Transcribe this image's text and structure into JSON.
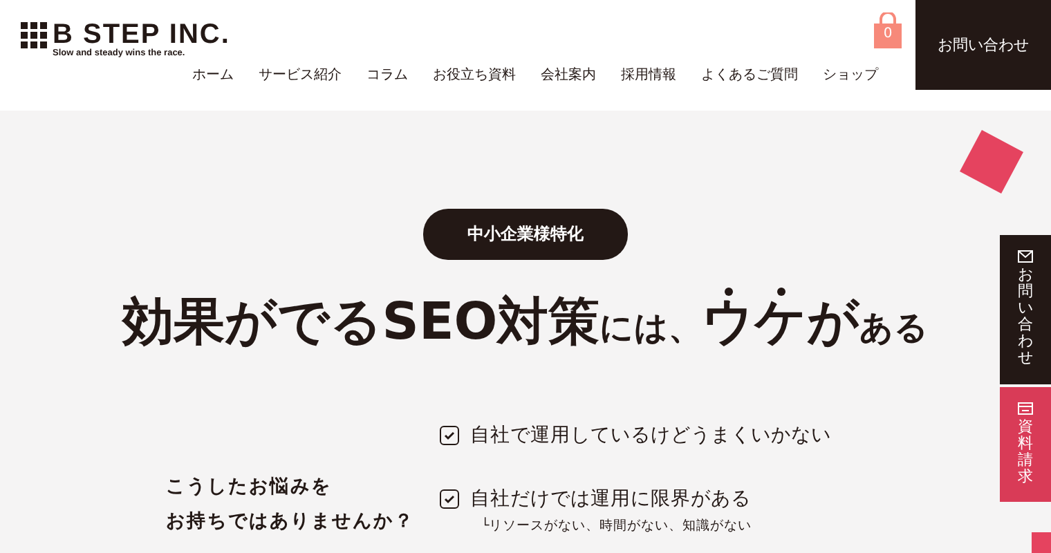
{
  "header": {
    "logo": {
      "name": "B STEP INC.",
      "tagline": "Slow and steady wins the race."
    },
    "nav": [
      "ホーム",
      "サービス紹介",
      "コラム",
      "お役立ち資料",
      "会社案内",
      "採用情報",
      "よくあるご質問",
      "ショップ"
    ],
    "cart_count": "0",
    "contact_button": "お問い合わせ"
  },
  "hero": {
    "badge": "中小企業様特化",
    "headline": [
      {
        "text": "効果がでるSEO対策",
        "large": true,
        "emphasis": false
      },
      {
        "text": "には、",
        "large": false,
        "emphasis": false
      },
      {
        "text": "ウケ",
        "large": true,
        "emphasis": true
      },
      {
        "text": "が",
        "large": true,
        "emphasis": false
      },
      {
        "text": "ある",
        "large": false,
        "emphasis": false
      }
    ]
  },
  "worries": {
    "question": [
      "こうしたお悩みを",
      "お持ちではありませんか？"
    ],
    "items": [
      {
        "text": "自社で運用しているけどうまくいかない",
        "checked": true
      },
      {
        "text": "自社だけでは運用に限界がある",
        "checked": true,
        "note": "└リソースがない、時間がない、知識がない"
      }
    ]
  },
  "side_tabs": [
    {
      "kind": "mail",
      "label": "お問い合わせ",
      "color": "#231815"
    },
    {
      "kind": "document",
      "label": "資料請求",
      "color": "#d93b57"
    }
  ]
}
